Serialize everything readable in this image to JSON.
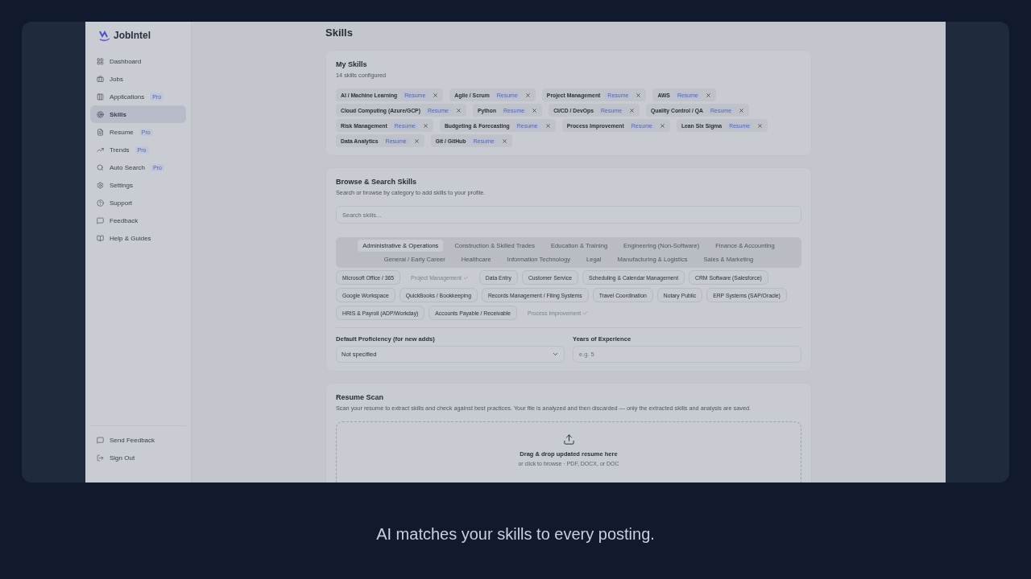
{
  "logo": {
    "name": "JobIntel"
  },
  "sidebar": {
    "items": [
      {
        "label": "Dashboard",
        "selected": false
      },
      {
        "label": "Jobs",
        "selected": false
      },
      {
        "label": "Applications",
        "badge": "Pro",
        "selected": false
      },
      {
        "label": "Skills",
        "selected": true
      },
      {
        "label": "Resume",
        "badge": "Pro",
        "selected": false
      },
      {
        "label": "Trends",
        "badge": "Pro",
        "selected": false
      },
      {
        "label": "Auto Search",
        "badge": "Pro",
        "selected": false
      },
      {
        "label": "Settings",
        "selected": false
      },
      {
        "label": "Support",
        "selected": false
      },
      {
        "label": "Feedback",
        "selected": false
      },
      {
        "label": "Help & Guides",
        "selected": false
      }
    ],
    "footer": [
      {
        "label": "Send Feedback"
      },
      {
        "label": "Sign Out"
      }
    ]
  },
  "page_title": "Skills",
  "my_skills": {
    "title": "My Skills",
    "subtitle": "14 skills configured",
    "tags": [
      {
        "name": "AI / Machine Learning",
        "badge": "Resume"
      },
      {
        "name": "Agile / Scrum",
        "badge": "Resume"
      },
      {
        "name": "Project Management",
        "badge": "Resume"
      },
      {
        "name": "AWS",
        "badge": "Resume"
      },
      {
        "name": "Cloud Computing (Azure/GCP)",
        "badge": "Resume"
      },
      {
        "name": "Python",
        "badge": "Resume"
      },
      {
        "name": "CI/CD / DevOps",
        "badge": "Resume"
      },
      {
        "name": "Quality Control / QA",
        "badge": "Resume"
      },
      {
        "name": "Risk Management",
        "badge": "Resume"
      },
      {
        "name": "Budgeting & Forecasting",
        "badge": "Resume"
      },
      {
        "name": "Process Improvement",
        "badge": "Resume"
      },
      {
        "name": "Lean Six Sigma",
        "badge": "Resume"
      },
      {
        "name": "Data Analytics",
        "badge": "Resume"
      },
      {
        "name": "Git / GitHub",
        "badge": "Resume"
      }
    ]
  },
  "browse": {
    "title": "Browse & Search Skills",
    "subtitle": "Search or browse by category to add skills to your profile.",
    "search": {
      "placeholder": "Search skills..."
    },
    "categories": [
      {
        "label": "Administrative & Operations",
        "selected": true
      },
      {
        "label": "Construction & Skilled Trades",
        "selected": false
      },
      {
        "label": "Education & Training",
        "selected": false
      },
      {
        "label": "Engineering (Non-Software)",
        "selected": false
      },
      {
        "label": "Finance & Accounting",
        "selected": false
      },
      {
        "label": "General / Early Career",
        "selected": false
      },
      {
        "label": "Healthcare",
        "selected": false
      },
      {
        "label": "Information Technology",
        "selected": false
      },
      {
        "label": "Legal",
        "selected": false
      },
      {
        "label": "Manufacturing & Logistics",
        "selected": false
      },
      {
        "label": "Sales & Marketing",
        "selected": false
      }
    ],
    "skills": [
      {
        "name": "Microsoft Office / 365",
        "added": false
      },
      {
        "name": "Project Management",
        "added": true
      },
      {
        "name": "Data Entry",
        "added": false
      },
      {
        "name": "Customer Service",
        "added": false
      },
      {
        "name": "Scheduling & Calendar Management",
        "added": false
      },
      {
        "name": "CRM Software (Salesforce)",
        "added": false
      },
      {
        "name": "Google Workspace",
        "added": false
      },
      {
        "name": "QuickBooks / Bookkeeping",
        "added": false
      },
      {
        "name": "Records Management / Filing Systems",
        "added": false
      },
      {
        "name": "Travel Coordination",
        "added": false
      },
      {
        "name": "Notary Public",
        "added": false
      },
      {
        "name": "ERP Systems (SAP/Oracle)",
        "added": false
      },
      {
        "name": "HRIS & Payroll (ADP/Workday)",
        "added": false
      },
      {
        "name": "Accounts Payable / Receivable",
        "added": false
      },
      {
        "name": "Process Improvement",
        "added": true
      }
    ],
    "proficiency": {
      "label": "Default Proficiency (for new adds)",
      "value": "Not specified"
    },
    "experience": {
      "label": "Years of Experience",
      "placeholder": "e.g. 5"
    }
  },
  "resume_scan": {
    "title": "Resume Scan",
    "subtitle": "Scan your resume to extract skills and check against best practices. Your file is analyzed and then discarded — only the extracted skills and analysis are saved.",
    "drop_title": "Drag & drop updated resume here",
    "drop_hint": "or click to browse · PDF, DOCX, or DOC"
  },
  "caption": "AI matches your skills to every posting."
}
